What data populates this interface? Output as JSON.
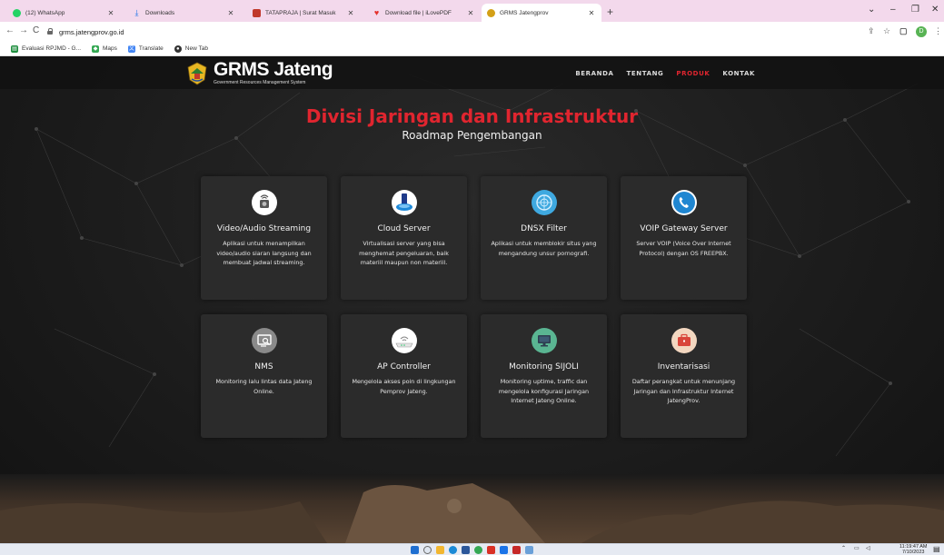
{
  "browser": {
    "tabs": [
      {
        "title": "(12) WhatsApp",
        "icon": "whatsapp-icon",
        "color": "#25d366"
      },
      {
        "title": "Downloads",
        "icon": "download-icon",
        "color": "#1a73e8"
      },
      {
        "title": "TATAPRAJA | Surat Masuk",
        "icon": "tatapraja-icon",
        "color": "#c0392b"
      },
      {
        "title": "Download file | iLovePDF",
        "icon": "ilovepdf-icon",
        "color": "#e5322d"
      },
      {
        "title": "GRMS Jatengprov",
        "icon": "grms-icon",
        "color": "#d4a017"
      }
    ],
    "url": "grms.jatengprov.go.id",
    "bookmarks": [
      {
        "label": "Evaluasi RPJMD - G...",
        "icon": "sheets-icon",
        "color": "#1e8e3e"
      },
      {
        "label": "Maps",
        "icon": "maps-icon",
        "color": "#34a853"
      },
      {
        "label": "Translate",
        "icon": "translate-icon",
        "color": "#4285f4"
      },
      {
        "label": "New Tab",
        "icon": "newtab-icon",
        "color": "#333333"
      }
    ],
    "profile_initial": "D"
  },
  "site": {
    "logo_name": "GRMS Jateng",
    "logo_sub": "Government Resources Management System",
    "nav": [
      {
        "label": "BERANDA",
        "active": false
      },
      {
        "label": "TENTANG",
        "active": false
      },
      {
        "label": "PRODUK",
        "active": true
      },
      {
        "label": "KONTAK",
        "active": false
      }
    ],
    "title": "Divisi Jaringan dan Infrastruktur",
    "subtitle": "Roadmap Pengembangan",
    "accent": "#e0252f"
  },
  "cards": [
    {
      "title": "Video/Audio Streaming",
      "desc": "Aplikasi untuk menampilkan video/audio siaran langsung dan membuat jadwal streaming.",
      "icon": "streaming-icon"
    },
    {
      "title": "Cloud Server",
      "desc": "Virtualisasi server yang bisa menghemat pengeluaran, baik materiil maupun non materiil.",
      "icon": "cloud-server-icon"
    },
    {
      "title": "DNSX Filter",
      "desc": "Aplikasi untuk memblokir situs yang mengandung unsur pornografi.",
      "icon": "dns-filter-icon"
    },
    {
      "title": "VOIP Gateway Server",
      "desc": "Server VOIP (Voice Over Internet Protocol) dengan OS FREEPBX.",
      "icon": "voip-icon"
    },
    {
      "title": "NMS",
      "desc": "Monitoring lalu lintas data Jateng Online.",
      "icon": "nms-icon"
    },
    {
      "title": "AP Controller",
      "desc": "Mengelola akses poin di lingkungan Pemprov Jateng.",
      "icon": "ap-controller-icon"
    },
    {
      "title": "Monitoring SIJOLI",
      "desc": "Monitoring uptime, traffic dan mengelola konfigurasi Jaringan Internet Jateng Online.",
      "icon": "monitor-icon"
    },
    {
      "title": "Inventarisasi",
      "desc": "Daftar perangkat untuk menunjang Jaringan dan Infrastruktur Internet JatengProv.",
      "icon": "inventory-icon"
    }
  ],
  "taskbar": {
    "time": "11:19:47 AM",
    "date": "7/10/2023"
  }
}
